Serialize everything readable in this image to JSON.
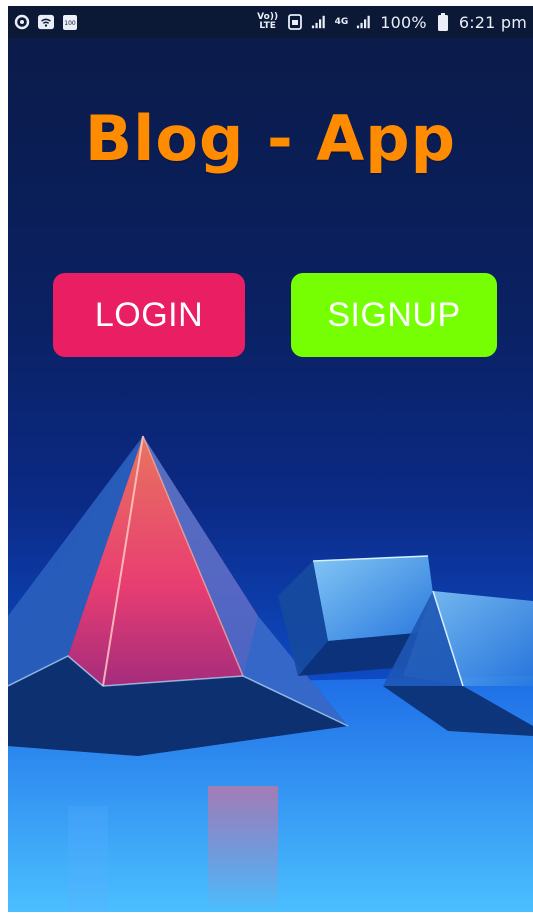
{
  "status_bar": {
    "battery_small": "100",
    "network_volte": "Vo)) LTE",
    "network_4g": "4G",
    "battery_percent": "100%",
    "time": "6:21 pm",
    "icons": [
      "sync-icon",
      "wifi-icon",
      "battery-saver-icon",
      "volte-icon",
      "sim-icon",
      "signal-icon",
      "signal-4g-icon",
      "battery-icon"
    ]
  },
  "app": {
    "title": "Blog - App",
    "title_color": "#ff8c00"
  },
  "buttons": {
    "login_label": "LOGIN",
    "login_color": "#e91e63",
    "signup_label": "SIGNUP",
    "signup_color": "#76ff03"
  },
  "background": {
    "icon": "glass-prism-illustration"
  }
}
